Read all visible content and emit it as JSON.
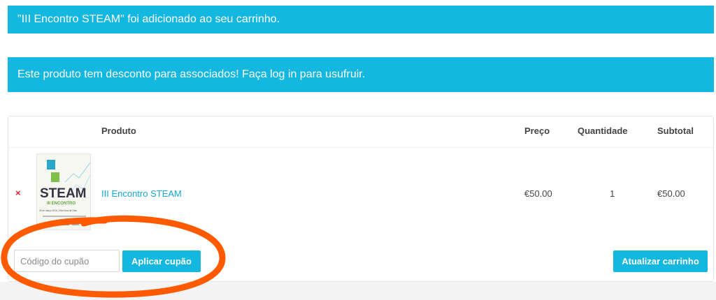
{
  "notices": {
    "added": "\"III Encontro STEAM\" foi adicionado ao seu carrinho.",
    "discount": "Este produto tem desconto para associados! Faça log in para usufruir."
  },
  "table": {
    "headers": {
      "product": "Produto",
      "price": "Preço",
      "quantity": "Quantidade",
      "subtotal": "Subtotal"
    },
    "rows": [
      {
        "remove": "×",
        "name": "III Encontro STEAM",
        "price": "€50.00",
        "quantity": "1",
        "subtotal": "€50.00",
        "thumbnail_text": {
          "big": "STEAM",
          "sub": "III ENCONTRO",
          "date": "25 de março 2016 | Vila Nova de Gaia"
        }
      }
    ]
  },
  "coupon": {
    "placeholder": "Código do cupão",
    "value": "",
    "apply_label": "Aplicar cupão"
  },
  "update_label": "Atualizar carrinho",
  "colors": {
    "accent": "#13b7df",
    "link": "#13a9d3",
    "remove": "#e0242c",
    "annotation": "#ff5a00"
  }
}
